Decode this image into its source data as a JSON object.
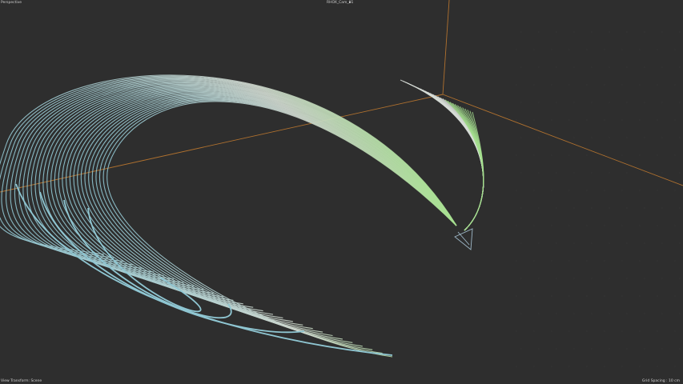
{
  "viewport": {
    "view_mode": "Perspective",
    "camera_name": "RHOX_Cam_01",
    "camera_menu_icon": "chevron-right-icon",
    "transform_hint": "View Transform: Scene",
    "grid_spacing": "Grid Spacing : 10 cm"
  },
  "scene": {
    "background_color": "#2e2e2e",
    "axis_color": "#b0712e",
    "curve_color_start": "#8fc6d2",
    "curve_color_end": "#a6e08f",
    "curve_count": 30
  }
}
